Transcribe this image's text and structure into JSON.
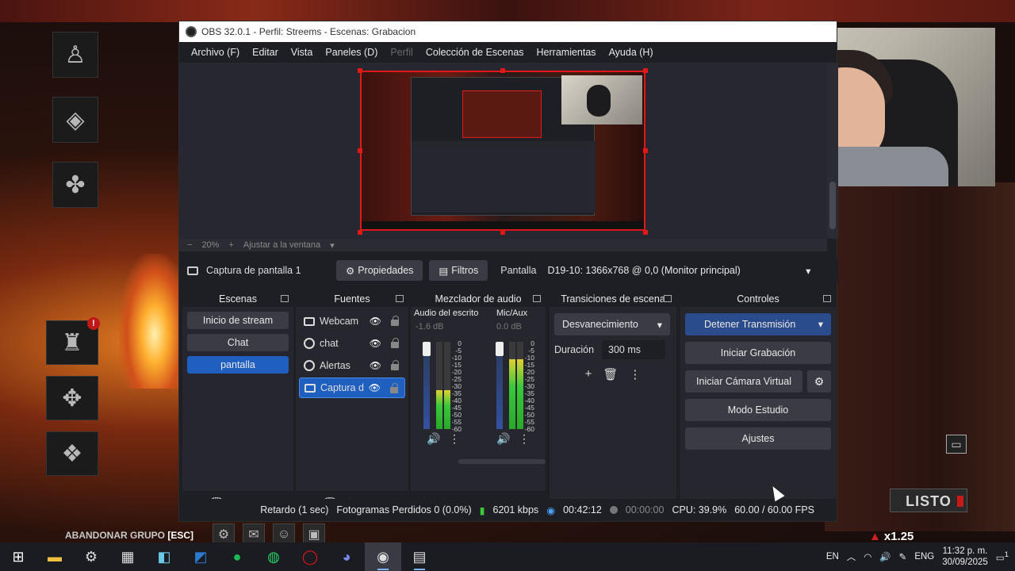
{
  "obs": {
    "title": "OBS 32.0.1 - Perfil: Streems - Escenas: Grabacion",
    "menu": [
      "Archivo (F)",
      "Editar",
      "Vista",
      "Paneles (D)",
      "Perfil",
      "Colección de Escenas",
      "Herramientas",
      "Ayuda (H)"
    ],
    "menu_disabled": [
      4
    ],
    "zoom": {
      "minus": "−",
      "value": "20%",
      "plus": "+",
      "fit": "Ajustar a la ventana"
    },
    "source_toolbar": {
      "source_name": "Captura de pantalla 1",
      "properties": "Propiedades",
      "filters": "Filtros",
      "display_label": "Pantalla",
      "display_value": "D19-10: 1366x768 @ 0,0 (Monitor principal)"
    },
    "scenes": {
      "header": "Escenas",
      "items": [
        "Inicio de stream",
        "Chat",
        "pantalla"
      ],
      "active_index": 2
    },
    "sources": {
      "header": "Fuentes",
      "items": [
        {
          "name": "Webcam",
          "icon": "camera-icon"
        },
        {
          "name": "chat",
          "icon": "browser-icon"
        },
        {
          "name": "Alertas",
          "icon": "browser-icon"
        },
        {
          "name": "Captura d",
          "icon": "monitor-icon"
        }
      ],
      "active_index": 3
    },
    "mixer": {
      "header": "Mezclador de audio",
      "channels": [
        {
          "name": "Audio del escrito",
          "db": "-1.6 dB",
          "level": 0.45
        },
        {
          "name": "Mic/Aux",
          "db": "0.0 dB",
          "level": 0.8
        }
      ],
      "scale": [
        "0",
        "-5",
        "-10",
        "-15",
        "-20",
        "-25",
        "-30",
        "-35",
        "-40",
        "-45",
        "-50",
        "-55",
        "-60"
      ]
    },
    "transitions": {
      "header": "Transiciones de escena",
      "selected": "Desvanecimiento",
      "duration_label": "Duración",
      "duration_value": "300 ms"
    },
    "controls": {
      "header": "Controles",
      "stop_stream": "Detener Transmisión",
      "start_record": "Iniciar Grabación",
      "virtual_cam": "Iniciar Cámara Virtual",
      "studio_mode": "Modo Estudio",
      "settings": "Ajustes"
    },
    "status": {
      "delay": "Retardo (1 sec)",
      "dropped": "Fotogramas Perdidos 0 (0.0%)",
      "bitrate": "6201 kbps",
      "stream_time": "00:42:12",
      "rec_time": "00:00:00",
      "cpu": "CPU: 39.9%",
      "fps": "60.00 / 60.00 FPS"
    }
  },
  "game": {
    "abandon": "ABANDONAR GRUPO",
    "abandon_key": "[ESC]",
    "ready": "LISTO",
    "multiplier": "x1.25",
    "perk_badge": "!"
  },
  "taskbar": {
    "lang": "EN",
    "lang2": "ENG",
    "time": "11:32 p. m.",
    "date": "30/09/2025",
    "notif": "1"
  },
  "colors": {
    "accent": "#1f5fbf",
    "stream_button": "#2b4c8c",
    "selection_border": "#e01818"
  }
}
